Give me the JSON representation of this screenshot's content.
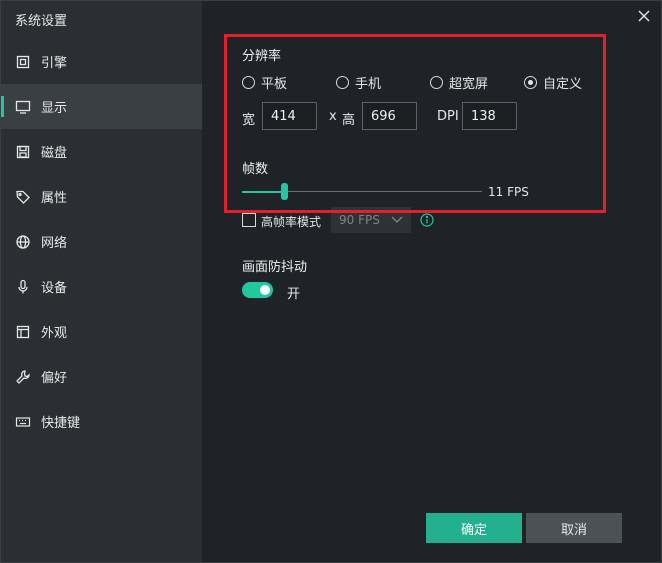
{
  "window": {
    "title": "系统设置"
  },
  "sidebar": {
    "items": [
      {
        "label": "引擎",
        "icon": "chip-icon"
      },
      {
        "label": "显示",
        "icon": "monitor-icon",
        "active": true
      },
      {
        "label": "磁盘",
        "icon": "disk-icon"
      },
      {
        "label": "属性",
        "icon": "tag-icon"
      },
      {
        "label": "网络",
        "icon": "globe-icon"
      },
      {
        "label": "设备",
        "icon": "microphone-icon"
      },
      {
        "label": "外观",
        "icon": "window-icon"
      },
      {
        "label": "偏好",
        "icon": "wrench-icon"
      },
      {
        "label": "快捷键",
        "icon": "keyboard-icon"
      }
    ]
  },
  "resolution": {
    "title": "分辨率",
    "options": [
      "平板",
      "手机",
      "超宽屏",
      "自定义"
    ],
    "selected": "自定义",
    "width_label": "宽",
    "width_value": "414",
    "x_label": "x",
    "height_label": "高",
    "height_value": "696",
    "dpi_label": "DPI",
    "dpi_value": "138"
  },
  "fps": {
    "title": "帧数",
    "slider_value": 11,
    "value_text": "11 FPS",
    "high_fps_label": "高帧率模式",
    "high_fps_checked": false,
    "high_fps_select": "90 FPS"
  },
  "antishake": {
    "title": "画面防抖动",
    "enabled": true,
    "state_text": "开"
  },
  "buttons": {
    "ok": "确定",
    "cancel": "取消"
  },
  "colors": {
    "accent": "#22c7a0",
    "highlight": "#e0202a"
  }
}
